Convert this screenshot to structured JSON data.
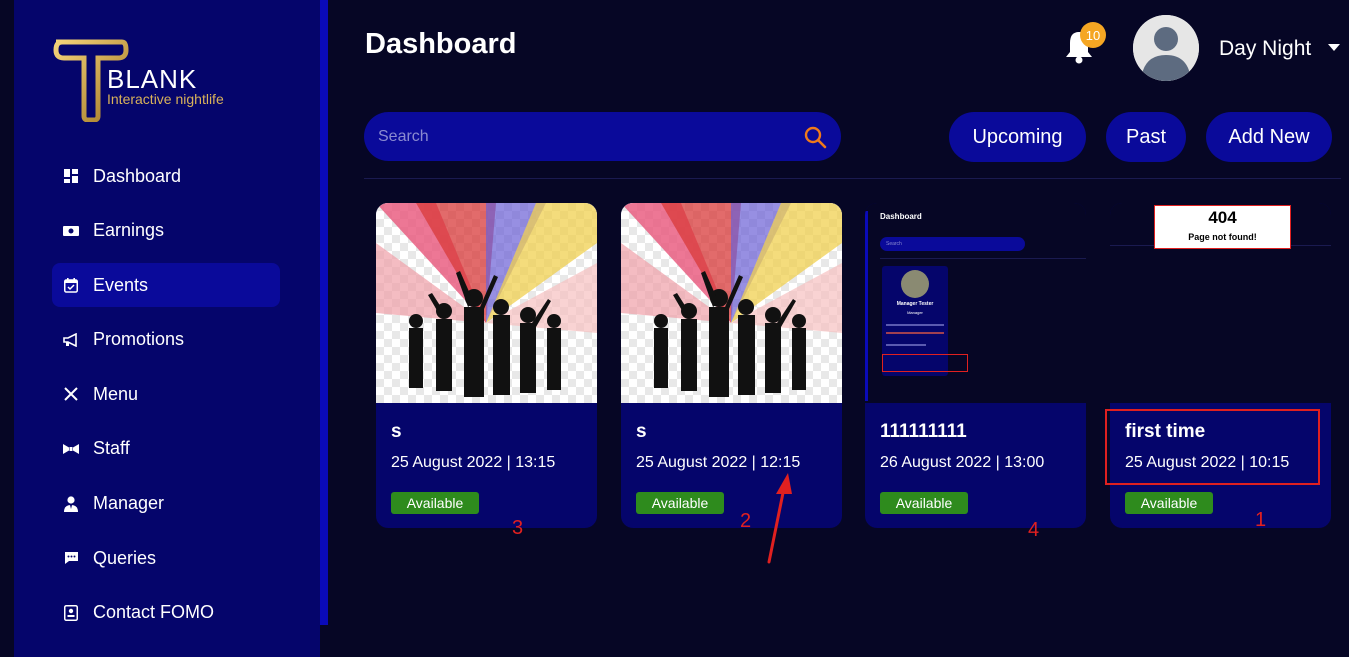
{
  "brand": {
    "name": "BLANK",
    "tagline": "Interactive nightlife",
    "logo_letter": "T"
  },
  "sidebar": {
    "items": [
      {
        "label": "Dashboard",
        "icon": "grid-icon"
      },
      {
        "label": "Earnings",
        "icon": "money-icon"
      },
      {
        "label": "Events",
        "icon": "calendar-icon",
        "active": true
      },
      {
        "label": "Promotions",
        "icon": "megaphone-icon"
      },
      {
        "label": "Menu",
        "icon": "utensils-icon"
      },
      {
        "label": "Staff",
        "icon": "bowtie-icon"
      },
      {
        "label": "Manager",
        "icon": "user-tie-icon"
      },
      {
        "label": "Queries",
        "icon": "chat-icon"
      },
      {
        "label": "Contact FOMO",
        "icon": "contact-icon"
      }
    ]
  },
  "header": {
    "title": "Dashboard",
    "notification_count": "10",
    "user_name": "Day Night"
  },
  "toolbar": {
    "search_placeholder": "Search",
    "upcoming_label": "Upcoming",
    "past_label": "Past",
    "add_new_label": "Add New"
  },
  "events": [
    {
      "title": "s",
      "date": "25 August 2022 | 13:15",
      "status": "Available",
      "annotation": "3"
    },
    {
      "title": "s",
      "date": "25 August 2022 | 12:15",
      "status": "Available",
      "annotation": "2"
    },
    {
      "title": "111111111",
      "date": "26 August 2022 | 13:00",
      "status": "Available",
      "annotation": "4"
    },
    {
      "title": "first time",
      "date": "25 August 2022 | 10:15",
      "status": "Available",
      "annotation": "1"
    }
  ],
  "thumb_dashboard": {
    "title": "Dashboard",
    "search": "Search",
    "manager_name": "Manager Tester",
    "manager_role": "Manager"
  },
  "thumb_404": {
    "code": "404",
    "message": "Page not found!"
  },
  "colors": {
    "accent": "#0a0a9a",
    "sidebar": "#05056b",
    "available": "#2e8b1d",
    "badge": "#f5a623",
    "annotation": "#e02020"
  }
}
